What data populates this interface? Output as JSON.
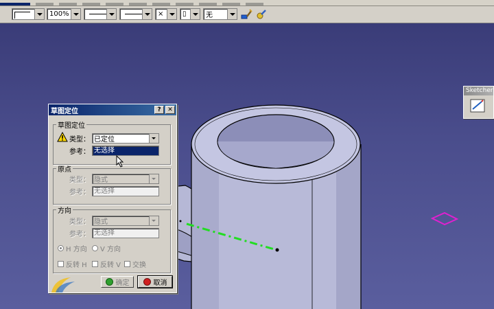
{
  "toolbar": {
    "zoom_value": "100%",
    "x_value": "×",
    "layer_value": "无"
  },
  "dialog": {
    "title": "草图定位",
    "help_btn": "?",
    "close_btn": "✕",
    "section1": {
      "legend": "草图定位",
      "type_label": "类型：",
      "type_value": "已定位",
      "ref_label": "参考：",
      "ref_value": "无选择"
    },
    "section2": {
      "legend": "原点",
      "type_label": "类型：",
      "type_value": "隐式",
      "ref_label": "参考：",
      "ref_value": "无选择"
    },
    "section3": {
      "legend": "方向",
      "type_label": "类型：",
      "type_value": "隐式",
      "ref_label": "参考：",
      "ref_value": "无选择",
      "h_dir": "H 方向",
      "v_dir": "V 方向",
      "reverse_h": "反转 H",
      "reverse_v": "反转 V",
      "swap": "交换"
    },
    "ok_label": "确定",
    "cancel_label": "取消"
  },
  "sketcher_toolbar": {
    "title": "Sketcher"
  },
  "colors": {
    "background": "#4a4d8a",
    "axis_line": "#22dd22",
    "sketch_plane": "#e020d0",
    "cylinder": "#b8bad8"
  }
}
